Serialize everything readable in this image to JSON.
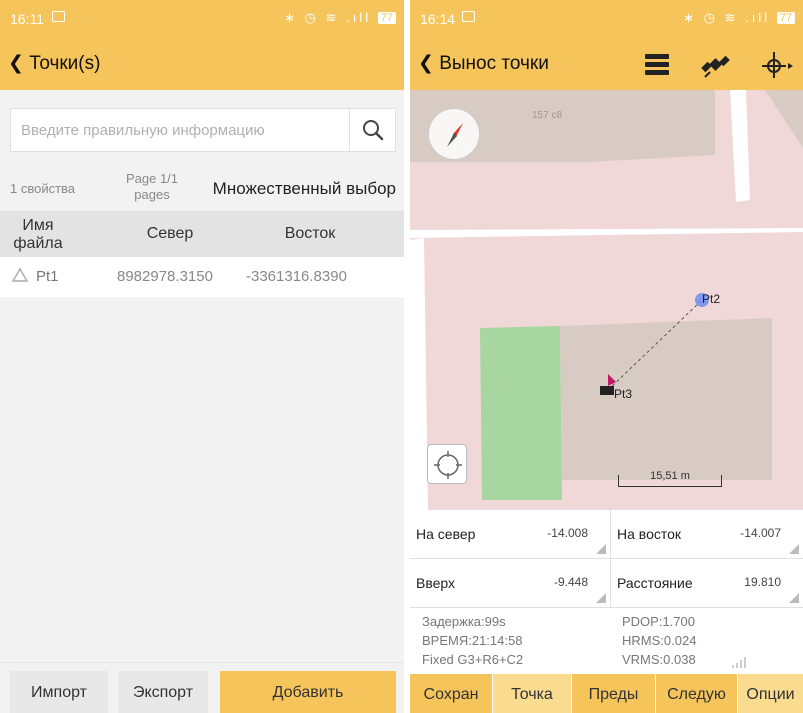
{
  "left": {
    "status": {
      "time": "16:11",
      "icons": "∗ ◷ ≋ .ıll",
      "battery": "77"
    },
    "title": "Точки(s)",
    "search": {
      "placeholder": "Введите правильную информацию"
    },
    "count_label": "1 свойства",
    "page_label": "Page 1/1",
    "page_sub": "pages",
    "multi_select": "Множественный выбор",
    "columns": {
      "name": "Имя файла",
      "north": "Север",
      "east": "Восток"
    },
    "rows": [
      {
        "name": "Pt1",
        "north": "8982978.3150",
        "east": "-3361316.8390"
      }
    ],
    "buttons": {
      "import": "Импорт",
      "export": "Экспорт",
      "add": "Добавить"
    }
  },
  "right": {
    "status": {
      "time": "16:14",
      "icons": "∗ ◷ ≋ .ıll",
      "battery": "77"
    },
    "title": "Вынос точки",
    "map": {
      "building_number": "157 с8",
      "target_label": "Pt2",
      "current_label": "Pt3",
      "scale_label": "15,51 m"
    },
    "info": {
      "north_label": "На север",
      "north_value": "-14.008",
      "east_label": "На восток",
      "east_value": "-14.007",
      "up_label": "Вверх",
      "up_value": "-9.448",
      "dist_label": "Расстояние",
      "dist_value": "19.810"
    },
    "stats": {
      "delay": "Задержка:99s",
      "time": "ВРЕМЯ:21:14:58",
      "fix": "Fixed  G3+R6+C2",
      "pdop": "PDOP:1.700",
      "hrms": "HRMS:0.024",
      "vrms": "VRMS:0.038"
    },
    "tabs": [
      "Сохран",
      "Точка",
      "Преды",
      "Следую",
      "Опции"
    ],
    "colors": {
      "accent": "#f5c55c",
      "map_pink": "#f0d8d8",
      "map_building": "#d8cbc4",
      "map_green": "#9cd19c"
    }
  }
}
